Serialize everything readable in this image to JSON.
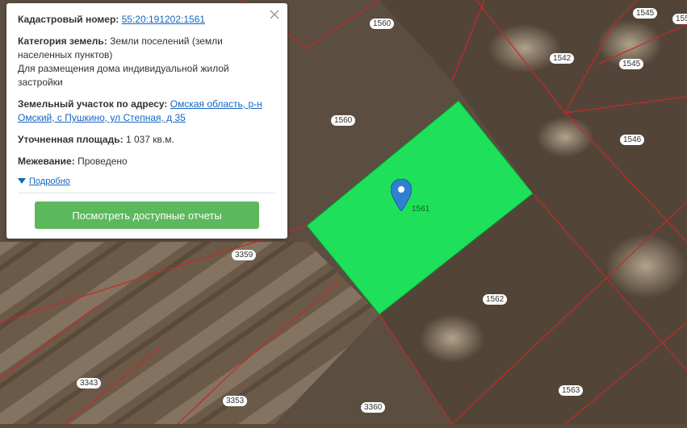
{
  "popup": {
    "cadastral_label": "Кадастровый номер:",
    "cadastral_number": "55:20:191202:1561",
    "category_label": "Категория земель:",
    "category_value": "Земли поселений (земли населенных пунктов)",
    "category_purpose": "Для размещения дома индивидуальной жилой застройки",
    "address_label": "Земельный участок по адресу:",
    "address_value": "Омская область, р-н Омский, с Пушкино, ул Степная, д 35",
    "area_label": "Уточненная площадь:",
    "area_value": "1 037 кв.м.",
    "survey_label": "Межевание:",
    "survey_value": "Проведено",
    "more_link": "Подробно",
    "report_button": "Посмотреть доступные отчеты"
  },
  "map": {
    "selected_color": "#1fe05a",
    "boundary_color": "#c62828",
    "parcel_labels": [
      "1560",
      "1560",
      "1542",
      "1545",
      "1545",
      "1546",
      "1561",
      "3359",
      "1562",
      "3343",
      "3353",
      "3360",
      "1563",
      "155"
    ]
  }
}
